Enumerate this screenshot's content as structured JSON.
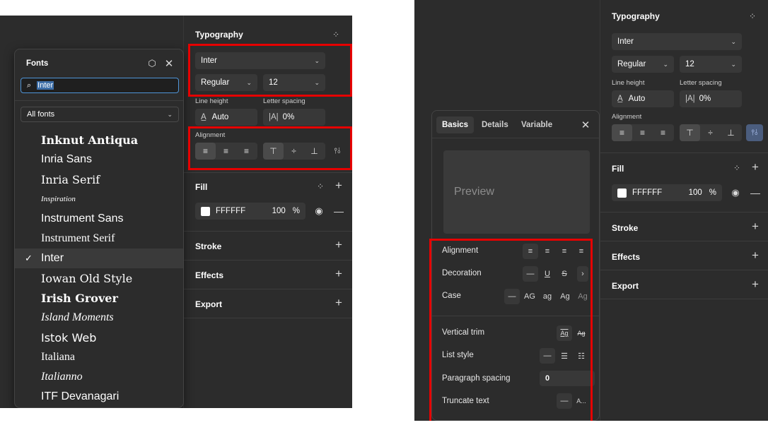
{
  "left": {
    "typography": {
      "title": "Typography",
      "font_family": "Inter",
      "font_weight": "Regular",
      "font_size": "12",
      "line_height_label": "Line height",
      "line_height_value": "Auto",
      "letter_spacing_label": "Letter spacing",
      "letter_spacing_value": "0%",
      "alignment_label": "Alignment"
    },
    "fill": {
      "title": "Fill",
      "color_hex": "FFFFFF",
      "opacity": "100",
      "unit": "%"
    },
    "stroke": {
      "title": "Stroke"
    },
    "effects": {
      "title": "Effects"
    },
    "export": {
      "title": "Export"
    },
    "fonts_popover": {
      "title": "Fonts",
      "search_value": "Inter",
      "filter_value": "All fonts",
      "items": [
        {
          "label": "Inknut Antiqua",
          "selected": false
        },
        {
          "label": "Inria Sans",
          "selected": false
        },
        {
          "label": "Inria Serif",
          "selected": false
        },
        {
          "label": "Inspiration",
          "selected": false
        },
        {
          "label": "Instrument Sans",
          "selected": false
        },
        {
          "label": "Instrument Serif",
          "selected": false
        },
        {
          "label": "Inter",
          "selected": true
        },
        {
          "label": "Iowan Old Style",
          "selected": false
        },
        {
          "label": "Irish Grover",
          "selected": false
        },
        {
          "label": "Island Moments",
          "selected": false
        },
        {
          "label": "Istok Web",
          "selected": false
        },
        {
          "label": "Italiana",
          "selected": false
        },
        {
          "label": "Italianno",
          "selected": false
        },
        {
          "label": "ITF Devanagari",
          "selected": false
        }
      ]
    }
  },
  "right": {
    "typography": {
      "title": "Typography",
      "font_family": "Inter",
      "font_weight": "Regular",
      "font_size": "12",
      "line_height_label": "Line height",
      "line_height_value": "Auto",
      "letter_spacing_label": "Letter spacing",
      "letter_spacing_value": "0%",
      "alignment_label": "Alignment"
    },
    "fill": {
      "title": "Fill",
      "color_hex": "FFFFFF",
      "opacity": "100",
      "unit": "%"
    },
    "stroke": {
      "title": "Stroke"
    },
    "effects": {
      "title": "Effects"
    },
    "export": {
      "title": "Export"
    },
    "basics_popover": {
      "tabs": [
        "Basics",
        "Details",
        "Variable"
      ],
      "active_tab": "Basics",
      "preview_text": "Preview",
      "alignment_label": "Alignment",
      "decoration_label": "Decoration",
      "case_label": "Case",
      "case_options": [
        "AG",
        "ag",
        "Ag",
        "Ag"
      ],
      "vertical_trim_label": "Vertical trim",
      "vertical_trim_options": [
        "Ag",
        "Ag"
      ],
      "list_style_label": "List style",
      "paragraph_spacing_label": "Paragraph spacing",
      "paragraph_spacing_value": "0",
      "truncate_label": "Truncate text",
      "truncate_option": "A..."
    }
  },
  "colors": {
    "highlight": "#e60000",
    "panel_bg": "#2c2c2c",
    "field_bg": "#383838",
    "focus_blue": "#4f95d8"
  }
}
